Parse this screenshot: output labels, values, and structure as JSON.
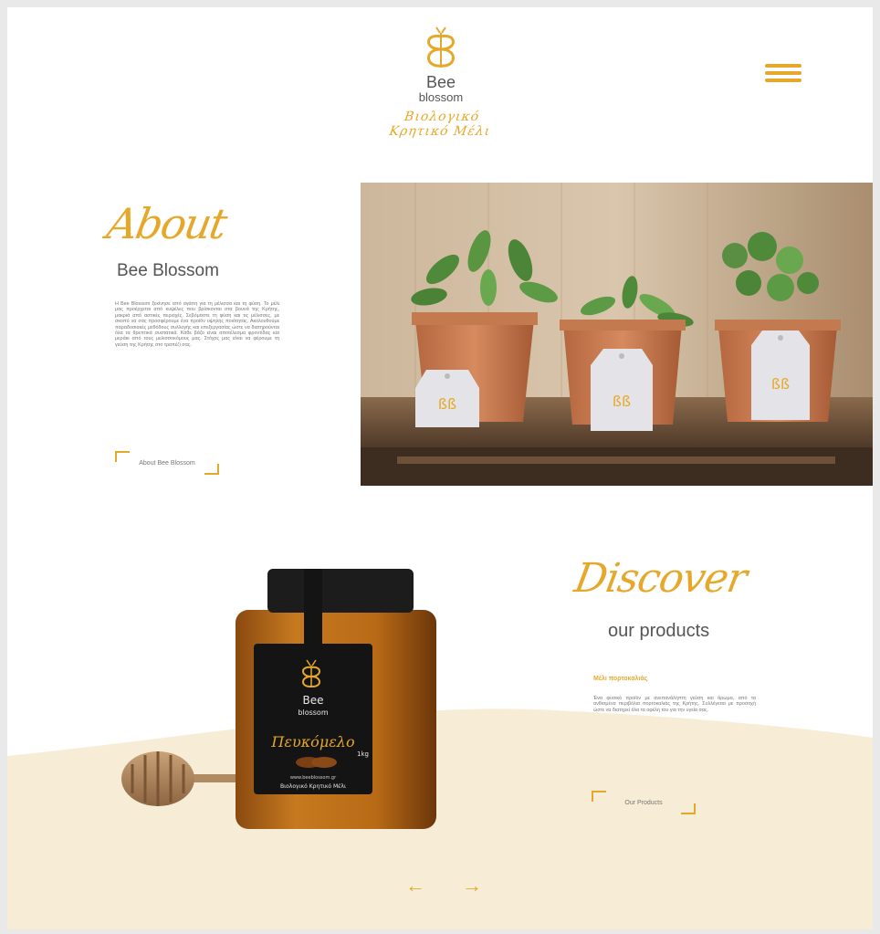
{
  "header": {
    "logo_word1": "Bee",
    "logo_word2": "blossom",
    "logo_tagline": "Βιολογικό Κρητικό Μέλι",
    "menu_icon": "hamburger-menu-icon"
  },
  "about": {
    "script_heading": "About",
    "title": "Bee Blossom",
    "text": "Η Bee Blossom ξεκίνησε από αγάπη για τη μέλισσα και τη φύση. Το μέλι μας προέρχεται από κυψέλες που βρίσκονται στα βουνά της Κρήτης, μακριά από αστικές περιοχές. Σεβόμαστε τη φύση και τις μέλισσες, με σκοπό να σας προσφέρουμε ένα προϊόν υψηλής ποιότητας. Ακολουθούμε παραδοσιακές μεθόδους συλλογής και επεξεργασίας ώστε να διατηρούνται όλα τα θρεπτικά συστατικά. Κάθε βάζο είναι αποτέλεσμα φροντίδας και μεράκι από τους μελισσοκόμους μας. Στόχος μας είναι να φέρουμε τη γεύση της Κρήτης στο τραπέζι σας.",
    "button_label": "About Bee Blossom"
  },
  "discover": {
    "script_heading": "Discover",
    "title": "our products",
    "subheading": "Μέλι πορτοκαλιάς",
    "text": "Ένα φυσικό προϊόν με ανεπανάληπτη γεύση και άρωμα, από τα ανθισμένα περιβόλια πορτοκαλιάς της Κρήτης. Συλλέγεται με προσοχή ώστε να διατηρεί όλα τα οφέλη του για την υγεία σας.",
    "button_label": "Our Products"
  },
  "jar_label": {
    "brand1": "Bee",
    "brand2": "blossom",
    "product": "Πευκόμελο",
    "website": "www.beeblossom.gr",
    "origin": "Βιολογικό Κρητικό Μέλι",
    "weight": "1kg"
  },
  "nav": {
    "prev_icon": "arrow-left-icon",
    "next_icon": "arrow-right-icon"
  },
  "colors": {
    "accent": "#e6a82a",
    "cream": "#f7ecd5",
    "text": "#555555"
  }
}
